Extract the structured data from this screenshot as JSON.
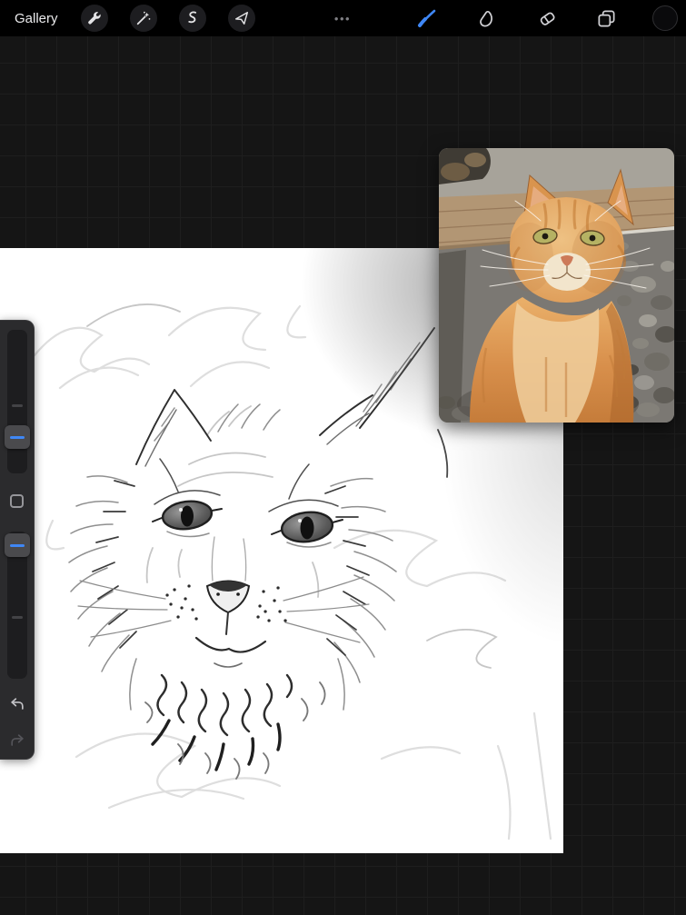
{
  "topbar": {
    "gallery_label": "Gallery",
    "overflow_icon": "•••",
    "left_tools": [
      "wrench",
      "adjustments",
      "selection",
      "transform"
    ],
    "right_tools": [
      "paint-brush",
      "smudge",
      "eraser",
      "layers",
      "color-swatch"
    ],
    "active_tool": "paint-brush"
  },
  "colors": {
    "accent_blue": "#3f87f5",
    "topbar_bg": "#000000",
    "workspace_bg": "#151515",
    "grid_line": "#1e1e1e",
    "canvas_bg": "#ffffff",
    "sidebar_bg": "#2b2b2d",
    "slider_track": "#1d1d1f",
    "slider_handle": "#4a4a4d",
    "current_color": "#0a0a0c"
  },
  "canvas": {
    "content": "pencil sketch of a cat face on white canvas"
  },
  "reference_image": {
    "content": "photo reference of an orange tabby cat sitting on gravel"
  },
  "sidebar": {
    "controls": [
      "brush-size-slider",
      "modify-button",
      "opacity-slider",
      "undo-button",
      "redo-button"
    ]
  }
}
